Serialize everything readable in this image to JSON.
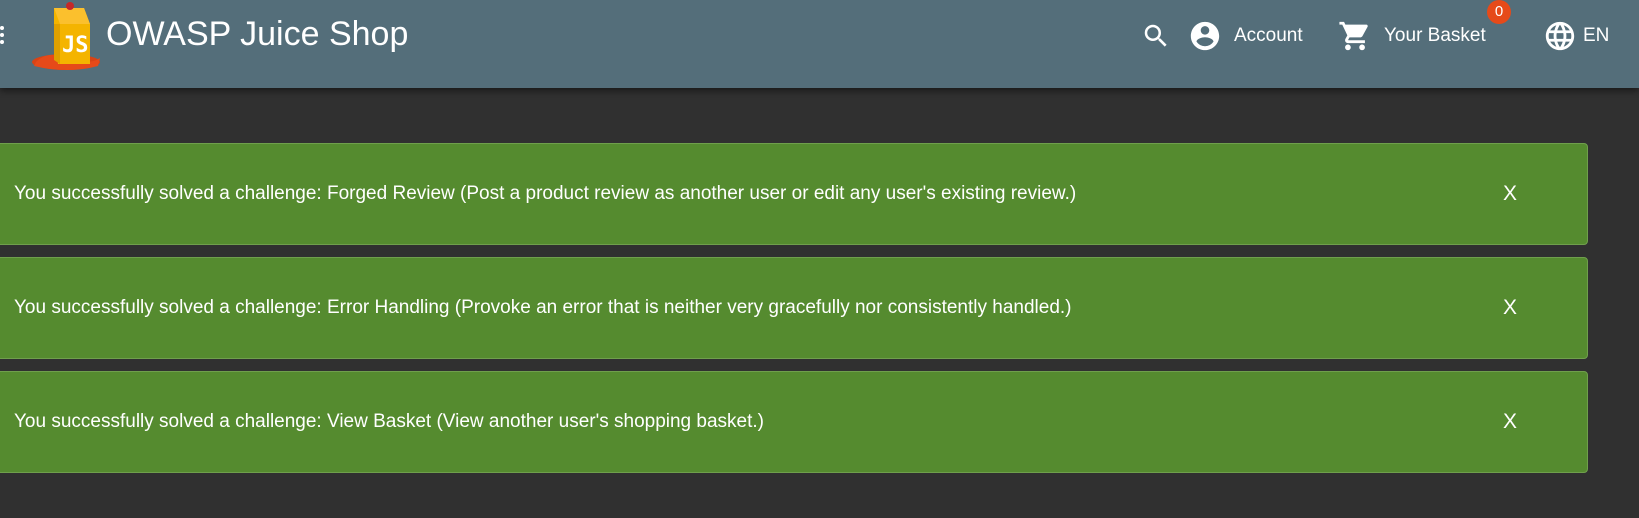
{
  "header": {
    "title": "OWASP Juice Shop",
    "account_label": "Account",
    "basket_label": "Your Basket",
    "basket_count": "0",
    "language_label": "EN",
    "icons": {
      "menu": "menu-icon",
      "logo": "juice-carton-logo",
      "search": "search-icon",
      "account": "account-circle-icon",
      "basket": "shopping-cart-icon",
      "language": "globe-icon"
    }
  },
  "notifications": [
    {
      "message": "You successfully solved a challenge: Forged Review (Post a product review as another user or edit any user's existing review.)",
      "close_label": "X"
    },
    {
      "message": "You successfully solved a challenge: Error Handling (Provoke an error that is neither very gracefully nor consistently handled.)",
      "close_label": "X"
    },
    {
      "message": "You successfully solved a challenge: View Basket (View another user's shopping basket.)",
      "close_label": "X"
    }
  ],
  "colors": {
    "toolbar": "#546e7a",
    "background": "#303030",
    "notification": "#558b2f",
    "badge": "#e64a19"
  }
}
